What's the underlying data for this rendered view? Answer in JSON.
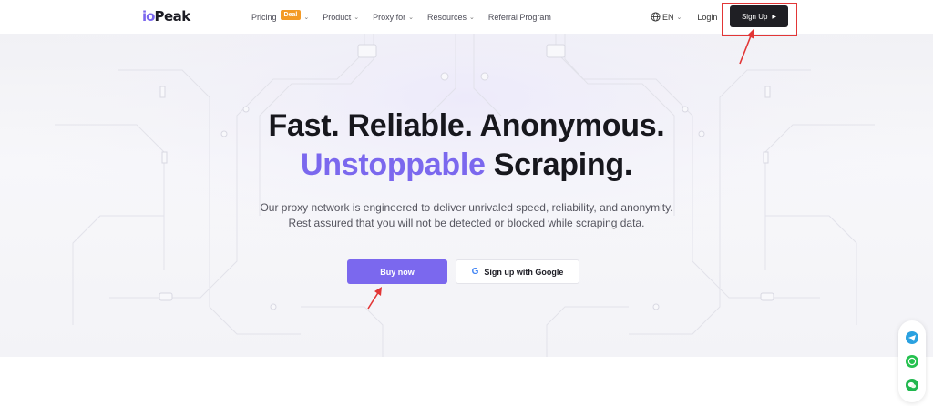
{
  "nav": {
    "logo_mark": "io",
    "logo_text": "Peak",
    "items": [
      {
        "label": "Pricing",
        "badge": "Deal",
        "has_chevron": true
      },
      {
        "label": "Product",
        "has_chevron": true
      },
      {
        "label": "Proxy for",
        "has_chevron": true
      },
      {
        "label": "Resources",
        "has_chevron": true
      },
      {
        "label": "Referral Program",
        "has_chevron": false
      }
    ],
    "language": "EN",
    "login": "Login",
    "signup": "Sign Up"
  },
  "hero": {
    "title_line1": "Fast. Reliable. Anonymous.",
    "title_line2_accent": "Unstoppable",
    "title_line2_rest": " Scraping.",
    "subtitle_line1": "Our proxy network is engineered to deliver unrivaled speed, reliability, and anonymity.",
    "subtitle_line2": "Rest assured that you will not be detected or blocked while scraping data.",
    "buy_button": "Buy now",
    "google_button": "Sign up with Google",
    "google_glyph": "G"
  },
  "side_contacts": [
    "telegram-icon",
    "whatsapp-icon",
    "wechat-icon"
  ],
  "colors": {
    "accent": "#7b68ee",
    "dark_button": "#1f1f24",
    "deal_badge": "#f39a26",
    "annotation_red": "#e23636"
  }
}
